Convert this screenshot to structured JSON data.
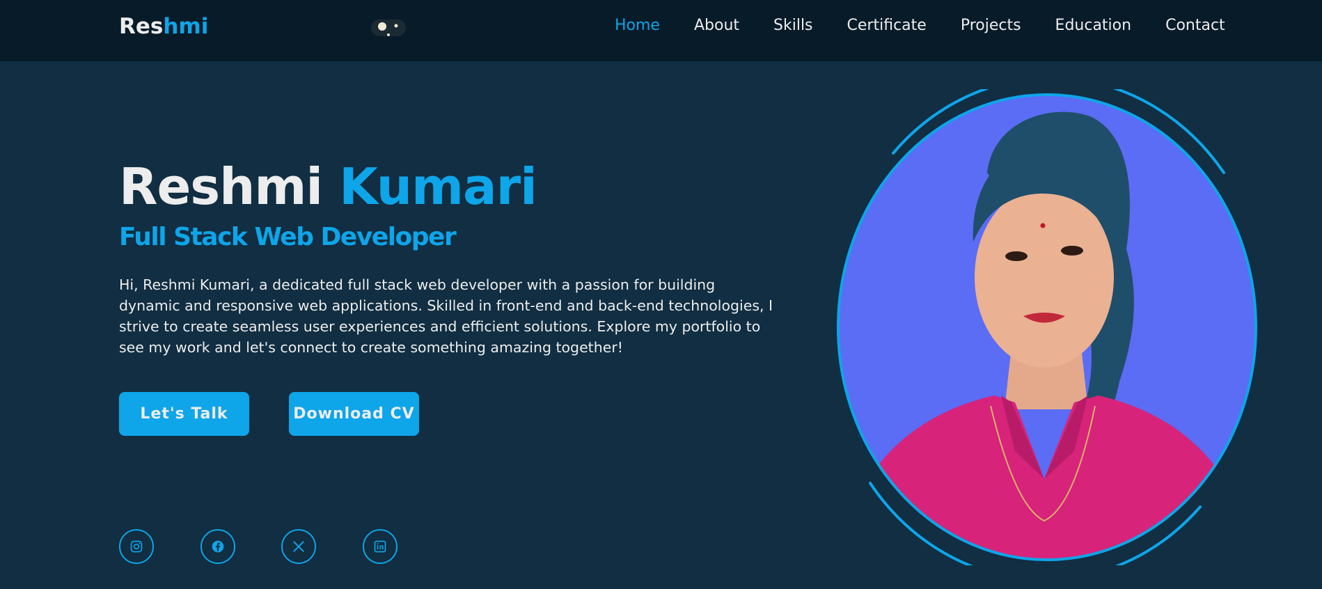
{
  "brand": {
    "logo_prefix": "Res",
    "logo_accent": "hmi"
  },
  "nav": {
    "items": [
      {
        "label": "Home",
        "active": true
      },
      {
        "label": "About"
      },
      {
        "label": "Skills"
      },
      {
        "label": "Certificate"
      },
      {
        "label": "Projects"
      },
      {
        "label": "Education"
      },
      {
        "label": "Contact"
      }
    ]
  },
  "hero": {
    "first_name": "Reshmi",
    "last_name": "Kumari",
    "role": "Full Stack Web Developer",
    "description": "Hi, Reshmi Kumari, a dedicated full stack web developer with a passion for building dynamic and responsive web applications. Skilled in front-end and back-end technologies, I strive to create seamless user experiences and efficient solutions. Explore my portfolio to see my work and let's connect to create something amazing together!",
    "buttons": {
      "talk": "Let's Talk",
      "cv": "Download CV"
    }
  },
  "social": [
    {
      "icon": "instagram-icon"
    },
    {
      "icon": "facebook-icon"
    },
    {
      "icon": "x-twitter-icon"
    },
    {
      "icon": "linkedin-icon"
    }
  ],
  "colors": {
    "accent": "#0ea5e9",
    "nav_bg": "#081b29",
    "page_bg": "#112e42",
    "text": "#ededed",
    "photo_bg": "#5b6cf5"
  }
}
